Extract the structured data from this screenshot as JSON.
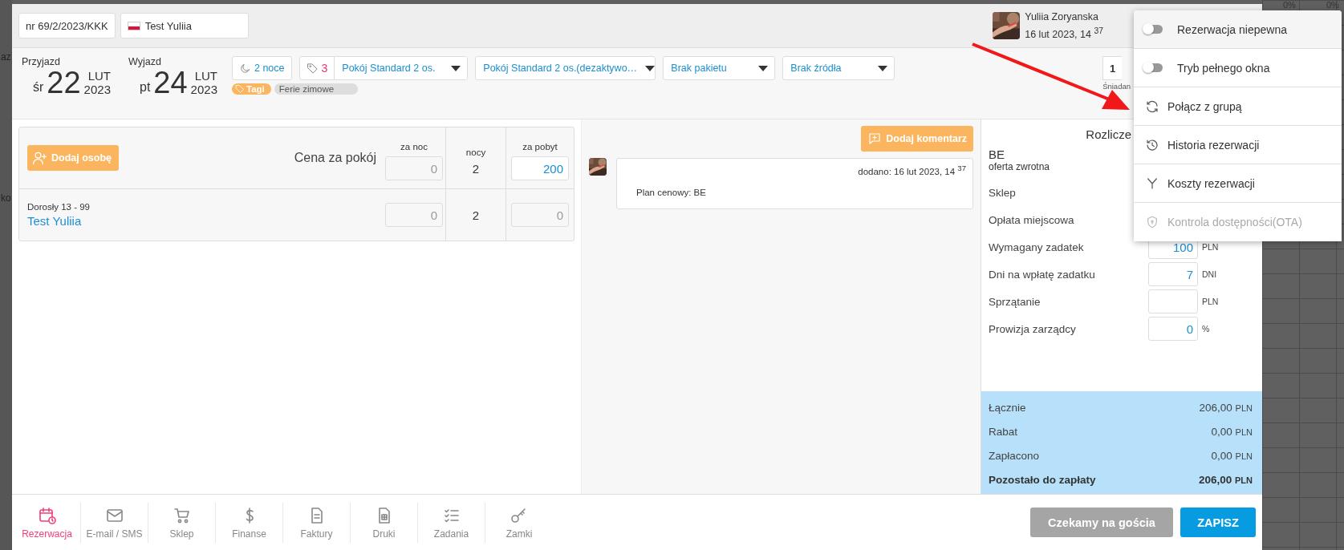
{
  "backdrop": {
    "left_fragments": [
      "az",
      "ko"
    ],
    "right_fragments": [
      "0%",
      "0%"
    ]
  },
  "header": {
    "reservation_number": "nr 69/2/2023/KKK",
    "guest_name": "Test Yuliia",
    "user": {
      "name": "Yuliia Zoryanska",
      "timestamp": "16 lut 2023, 14 $^{37}$"
    }
  },
  "stay": [
    {
      "label": "Przyjazd",
      "weekday": "śr",
      "day": "22",
      "month": "LUT",
      "year": "2023"
    },
    {
      "label": "Wyjazd",
      "weekday": "pt",
      "day": "24",
      "month": "LUT",
      "year": "2023"
    }
  ],
  "nights": "2 noce",
  "room_count": "3",
  "selects": [
    "Pokój Standard 2 os.",
    "Pokój Standard 2 os.(dezaktywo…",
    "Brak pakietu",
    "Brak źródła"
  ],
  "tags_button": "Tagi",
  "tags": [
    "Ferie zimowe"
  ],
  "breakfast": {
    "count": "1",
    "label": "Śniadan"
  },
  "pricing": {
    "add_person": "Dodaj osobę",
    "columns": [
      "za noc",
      "nocy",
      "za pobyt"
    ],
    "rows": [
      {
        "kind": "room",
        "label": "Cena za pokój",
        "per_night": "0",
        "nights": "2",
        "per_stay": "200"
      },
      {
        "kind": "person",
        "category": "Dorosły 13 - 99",
        "guest": "Test Yuliia",
        "per_night": "0",
        "nights": "2",
        "per_stay": "0"
      }
    ]
  },
  "comments": {
    "add_button": "Dodaj komentarz",
    "items": [
      {
        "added": "dodano: 16 lut 2023, 14 $^{37}$",
        "text": "Plan cenowy: BE"
      }
    ]
  },
  "settlement": {
    "title": "Rozlicze",
    "plan": {
      "name": "BE",
      "note": "oferta zwrotna"
    },
    "fields": [
      {
        "kind": "label",
        "label": "Sklep"
      },
      {
        "kind": "label",
        "label": "Opłata miejscowa"
      },
      {
        "kind": "input",
        "label": "Wymagany zadatek",
        "value": "100",
        "unit": "PLN"
      },
      {
        "kind": "input",
        "label": "Dni na wpłatę zadatku",
        "value": "7",
        "unit": "DNI"
      },
      {
        "kind": "input",
        "label": "Sprzątanie",
        "unit": "PLN"
      },
      {
        "kind": "input",
        "label": "Prowizja zarządcy",
        "value": "0",
        "unit": "%"
      }
    ]
  },
  "totals": [
    {
      "label": "Łącznie",
      "amount": "206,00",
      "unit": "PLN",
      "emphasis": false
    },
    {
      "label": "Rabat",
      "amount": "0,00",
      "unit": "PLN",
      "emphasis": false
    },
    {
      "label": "Zapłacono",
      "amount": "0,00",
      "unit": "PLN",
      "emphasis": false
    },
    {
      "label": "Pozostało do zapłaty",
      "amount": "206,00",
      "unit": "PLN",
      "emphasis": true
    }
  ],
  "footer": {
    "tabs": [
      {
        "label": "Rezerwacja",
        "selected": true
      },
      {
        "label": "E-mail / SMS",
        "selected": false
      },
      {
        "label": "Sklep",
        "selected": false
      },
      {
        "label": "Finanse",
        "selected": false
      },
      {
        "label": "Faktury",
        "selected": false
      },
      {
        "label": "Druki",
        "selected": false
      },
      {
        "label": "Zadania",
        "selected": false
      },
      {
        "label": "Zamki",
        "selected": false
      }
    ],
    "buttons": [
      {
        "label": "Czekamy na gościa",
        "kind": "secondary"
      },
      {
        "label": "ZAPISZ",
        "kind": "primary"
      }
    ]
  },
  "menu": {
    "items": [
      {
        "kind": "toggle",
        "label": "Rezerwacja niepewna",
        "on": false,
        "disabled": false
      },
      {
        "kind": "toggle",
        "label": "Tryb pełnego okna",
        "on": false,
        "disabled": false
      },
      {
        "kind": "action",
        "label": "Połącz z grupą",
        "disabled": false
      },
      {
        "kind": "action",
        "label": "Historia rezerwacji",
        "disabled": false
      },
      {
        "kind": "action",
        "label": "Koszty rezerwacji",
        "disabled": false
      },
      {
        "kind": "action",
        "label": "Kontrola dostępności(OTA)",
        "disabled": true
      }
    ]
  }
}
